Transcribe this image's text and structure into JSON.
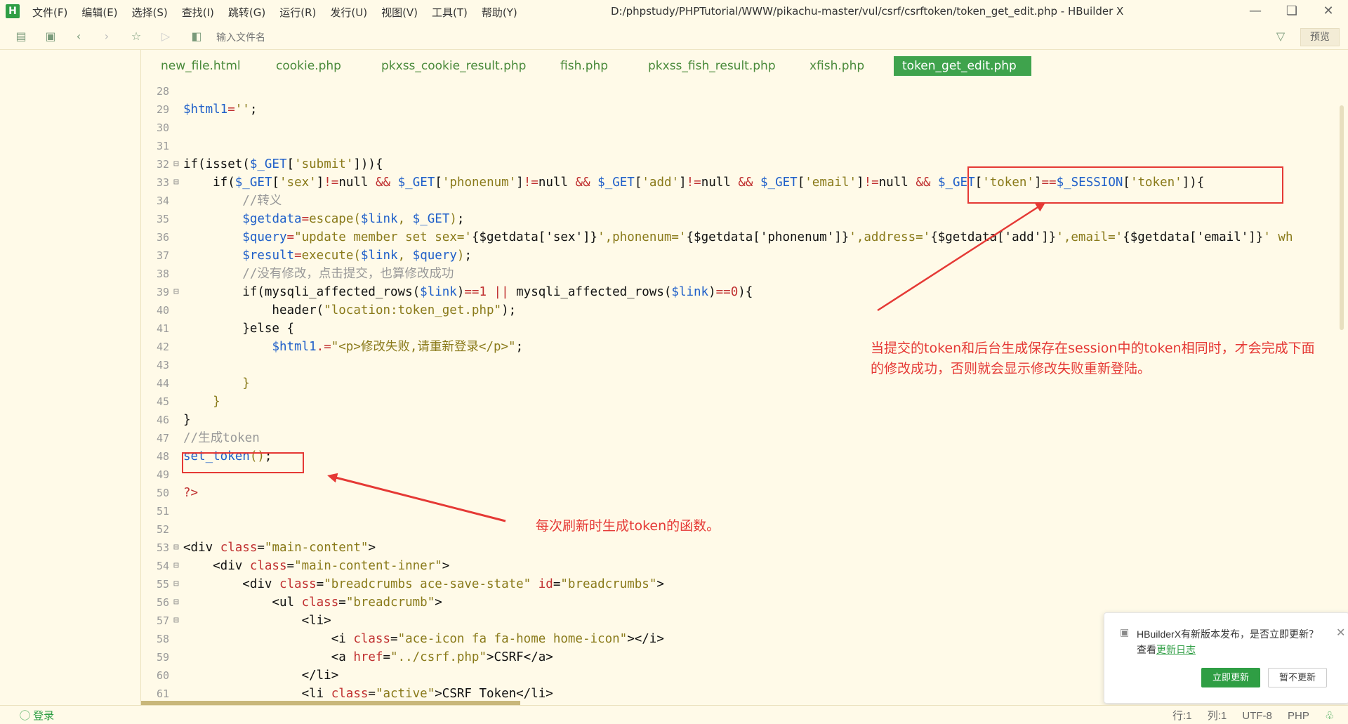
{
  "menubar": {
    "items": [
      "文件(F)",
      "编辑(E)",
      "选择(S)",
      "查找(I)",
      "跳转(G)",
      "运行(R)",
      "发行(U)",
      "视图(V)",
      "工具(T)",
      "帮助(Y)"
    ],
    "window_title": "D:/phpstudy/PHPTutorial/WWW/pikachu-master/vul/csrf/csrftoken/token_get_edit.php - HBuilder X",
    "logo": "H"
  },
  "toolbar": {
    "file_input_placeholder": "输入文件名",
    "preview_label": "预览"
  },
  "tabs": [
    "new_file.html",
    "cookie.php",
    "pkxss_cookie_result.php",
    "fish.php",
    "pkxss_fish_result.php",
    "xfish.php",
    "token_get_edit.php"
  ],
  "active_tab": "token_get_edit.php",
  "code_lines": [
    {
      "n": "28",
      "fold": "",
      "html": ""
    },
    {
      "n": "29",
      "fold": "",
      "html": "<span class='v'>$html1</span><span class='p'>=</span><span class='s'>''</span><span class='k'>;</span>"
    },
    {
      "n": "30",
      "fold": "",
      "html": ""
    },
    {
      "n": "31",
      "fold": "",
      "html": ""
    },
    {
      "n": "32",
      "fold": "⊟",
      "html": "<span class='k'>if(isset(</span><span class='v'>$_GET</span><span class='k'>[</span><span class='s'>'submit'</span><span class='k'>])){</span>"
    },
    {
      "n": "33",
      "fold": "⊟",
      "html": "<span class='k'>    if(</span><span class='v'>$_GET</span><span class='k'>[</span><span class='s'>'sex'</span><span class='k'>]</span><span class='p'>!=</span><span class='k'>null </span><span class='p'>&amp;&amp;</span><span class='k'> </span><span class='v'>$_GET</span><span class='k'>[</span><span class='s'>'phonenum'</span><span class='k'>]</span><span class='p'>!=</span><span class='k'>null </span><span class='p'>&amp;&amp;</span><span class='k'> </span><span class='v'>$_GET</span><span class='k'>[</span><span class='s'>'add'</span><span class='k'>]</span><span class='p'>!=</span><span class='k'>null </span><span class='p'>&amp;&amp;</span><span class='k'> </span><span class='v'>$_GET</span><span class='k'>[</span><span class='s'>'email'</span><span class='k'>]</span><span class='p'>!=</span><span class='k'>null </span><span class='p'>&amp;&amp;</span><span class='k'> </span><span class='v'>$_GET</span><span class='k'>[</span><span class='s'>'token'</span><span class='k'>]</span><span class='p'>==</span><span class='v'>$_SESSION</span><span class='k'>[</span><span class='s'>'token'</span><span class='k'>]){</span>"
    },
    {
      "n": "34",
      "fold": "",
      "html": "<span class='c'>        //转义</span>"
    },
    {
      "n": "35",
      "fold": "",
      "html": "<span class='k'>        </span><span class='v'>$getdata</span><span class='p'>=</span><span class='s'>escape(</span><span class='v'>$link</span><span class='s'>, </span><span class='v'>$_GET</span><span class='s'>)</span><span class='k'>;</span>"
    },
    {
      "n": "36",
      "fold": "",
      "html": "<span class='k'>        </span><span class='v'>$query</span><span class='p'>=</span><span class='s'>\"update member set sex='</span><span class='k'>{$getdata['sex']}</span><span class='s'>',phonenum='</span><span class='k'>{$getdata['phonenum']}</span><span class='s'>',address='</span><span class='k'>{$getdata['add']}</span><span class='s'>',email='</span><span class='k'>{$getdata['email']}</span><span class='s'>' wh</span>"
    },
    {
      "n": "37",
      "fold": "",
      "html": "<span class='k'>        </span><span class='v'>$result</span><span class='p'>=</span><span class='s'>execute(</span><span class='v'>$link</span><span class='s'>, </span><span class='v'>$query</span><span class='s'>)</span><span class='k'>;</span>"
    },
    {
      "n": "38",
      "fold": "",
      "html": "<span class='c'>        //没有修改，点击提交，也算修改成功</span>"
    },
    {
      "n": "39",
      "fold": "⊟",
      "html": "<span class='k'>        if(mysqli_affected_rows(</span><span class='v'>$link</span><span class='k'>)</span><span class='p'>==1 ||</span><span class='k'> mysqli_affected_rows(</span><span class='v'>$link</span><span class='k'>)</span><span class='p'>==0</span><span class='k'>){</span>"
    },
    {
      "n": "40",
      "fold": "",
      "html": "<span class='k'>            header(</span><span class='s'>\"location:token_get.php\"</span><span class='k'>);</span>"
    },
    {
      "n": "41",
      "fold": "",
      "html": "<span class='k'>        }else {</span>"
    },
    {
      "n": "42",
      "fold": "",
      "html": "<span class='k'>            </span><span class='v'>$html1</span><span class='p'>.=</span><span class='s'>\"&lt;p&gt;修改失败,请重新登录&lt;/p&gt;\"</span><span class='k'>;</span>"
    },
    {
      "n": "43",
      "fold": "",
      "html": ""
    },
    {
      "n": "44",
      "fold": "",
      "html": "<span class='s'>        }</span>"
    },
    {
      "n": "45",
      "fold": "",
      "html": "<span class='s'>    }</span>"
    },
    {
      "n": "46",
      "fold": "",
      "html": "<span class='k'>}</span>"
    },
    {
      "n": "47",
      "fold": "",
      "html": "<span class='c'>//生成token</span>"
    },
    {
      "n": "48",
      "fold": "",
      "html": "<span class='v'>set_token</span><span class='s'>()</span><span class='k'>;</span>"
    },
    {
      "n": "49",
      "fold": "",
      "html": ""
    },
    {
      "n": "50",
      "fold": "",
      "html": "<span class='p'>?&gt;</span>"
    },
    {
      "n": "51",
      "fold": "",
      "html": ""
    },
    {
      "n": "52",
      "fold": "",
      "html": ""
    },
    {
      "n": "53",
      "fold": "⊟",
      "html": "<span class='t'>&lt;div </span><span class='p'>class</span><span class='t'>=</span><span class='s'>\"main-content\"</span><span class='t'>&gt;</span>"
    },
    {
      "n": "54",
      "fold": "⊟",
      "html": "<span class='t'>    &lt;div </span><span class='p'>class</span><span class='t'>=</span><span class='s'>\"main-content-inner\"</span><span class='t'>&gt;</span>"
    },
    {
      "n": "55",
      "fold": "⊟",
      "html": "<span class='t'>        &lt;div </span><span class='p'>class</span><span class='t'>=</span><span class='s'>\"breadcrumbs ace-save-state\"</span><span class='t'> </span><span class='p'>id</span><span class='t'>=</span><span class='s'>\"breadcrumbs\"</span><span class='t'>&gt;</span>"
    },
    {
      "n": "56",
      "fold": "⊟",
      "html": "<span class='t'>            &lt;ul </span><span class='p'>class</span><span class='t'>=</span><span class='s'>\"breadcrumb\"</span><span class='t'>&gt;</span>"
    },
    {
      "n": "57",
      "fold": "⊟",
      "html": "<span class='t'>                &lt;li&gt;</span>"
    },
    {
      "n": "58",
      "fold": "",
      "html": "<span class='t'>                    &lt;i </span><span class='p'>class</span><span class='t'>=</span><span class='s'>\"ace-icon fa fa-home home-icon\"</span><span class='t'>&gt;&lt;/i&gt;</span>"
    },
    {
      "n": "59",
      "fold": "",
      "html": "<span class='t'>                    &lt;a </span><span class='p'>href</span><span class='t'>=</span><span class='s'>\"../csrf.php\"</span><span class='t'>&gt;CSRF&lt;/a&gt;</span>"
    },
    {
      "n": "60",
      "fold": "",
      "html": "<span class='t'>                &lt;/li&gt;</span>"
    },
    {
      "n": "61",
      "fold": "",
      "html": "<span class='t'>                &lt;li </span><span class='p'>class</span><span class='t'>=</span><span class='s'>\"active\"</span><span class='t'>&gt;CSRF Token&lt;/li&gt;</span>"
    }
  ],
  "annotations": {
    "note_token": "当提交的token和后台生成保存在session中的token相同时，才会完成下面的修改成功，否则就会显示修改失败重新登陆。",
    "note_token_line1": "当提交的token和后台生成保存在session中的token相同时，才会完成下面",
    "note_token_line2": "的修改成功，否则就会显示修改失败重新登陆。",
    "note_settoken": "每次刷新时生成token的函数。",
    "color": "#e53935"
  },
  "notification": {
    "message": "HBuilderX有新版本发布，是否立即更新？",
    "sub_prefix": "查看",
    "sub_link": "更新日志",
    "update_button": "立即更新",
    "later_button": "暂不更新"
  },
  "statusbar": {
    "login": "登录",
    "row": "行:1",
    "col": "列:1",
    "encoding": "UTF-8",
    "language": "PHP"
  },
  "colors": {
    "background": "#fffae8",
    "accent": "#3fa34d",
    "annotation": "#e53935"
  }
}
